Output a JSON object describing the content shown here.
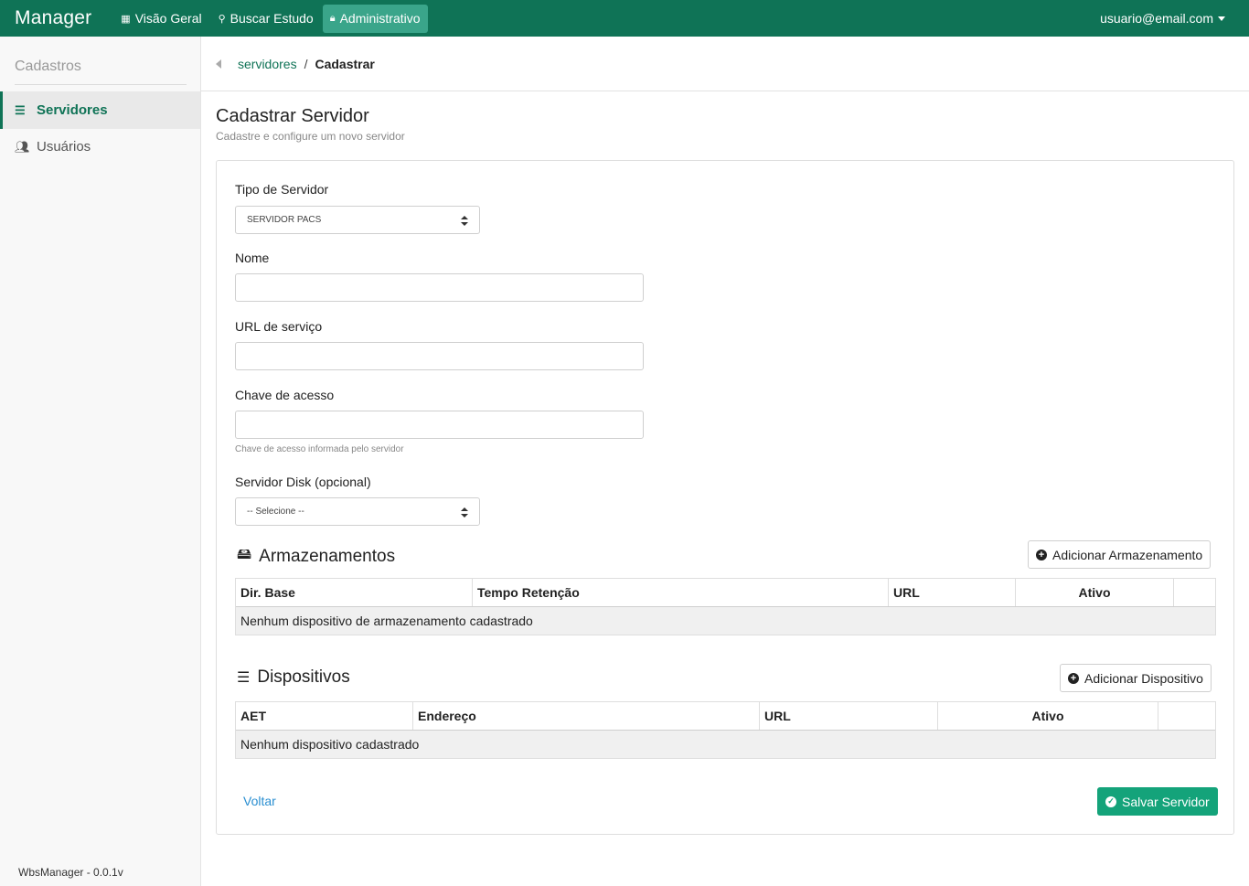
{
  "navbar": {
    "brand": "Manager",
    "items": [
      {
        "label": "Visão Geral",
        "icon": "dashboard-icon"
      },
      {
        "label": "Buscar Estudo",
        "icon": "search-icon"
      },
      {
        "label": "Administrativo",
        "icon": "lock-icon"
      }
    ],
    "user": "usuario@email.com"
  },
  "sidebar": {
    "title": "Cadastros",
    "items": [
      {
        "label": "Servidores",
        "icon": "server-icon"
      },
      {
        "label": "Usuários",
        "icon": "users-icon"
      }
    ],
    "footer": "WbsManager - 0.0.1v"
  },
  "breadcrumb": {
    "parent": "servidores",
    "separator": "/",
    "current": "Cadastrar"
  },
  "page": {
    "title": "Cadastrar Servidor",
    "subtitle": "Cadastre e configure um novo servidor"
  },
  "form": {
    "tipo_label": "Tipo de Servidor",
    "tipo_value": "SERVIDOR PACS",
    "nome_label": "Nome",
    "nome_value": "",
    "url_label": "URL de serviço",
    "url_value": "",
    "chave_label": "Chave de acesso",
    "chave_value": "",
    "chave_help": "Chave de acesso informada pelo servidor",
    "disk_label": "Servidor Disk (opcional)",
    "disk_value": "-- Selecione --"
  },
  "armazenamentos": {
    "title": "Armazenamentos",
    "icon": "hdd-icon",
    "add_label": "Adicionar Armazenamento",
    "columns": [
      "Dir. Base",
      "Tempo Retenção",
      "URL",
      "Ativo",
      ""
    ],
    "empty": "Nenhum dispositivo de armazenamento cadastrado"
  },
  "dispositivos": {
    "title": "Dispositivos",
    "icon": "server-icon",
    "add_label": "Adicionar Dispositivo",
    "columns": [
      "AET",
      "Endereço",
      "URL",
      "Ativo",
      ""
    ],
    "empty": "Nenhum dispositivo cadastrado"
  },
  "actions": {
    "back_label": "Voltar",
    "save_label": "Salvar Servidor"
  },
  "colors": {
    "navbar": "#0f7356",
    "nav_active": "#3aa58a",
    "primary_button": "#14a37a",
    "link": "#2b8fd1"
  }
}
